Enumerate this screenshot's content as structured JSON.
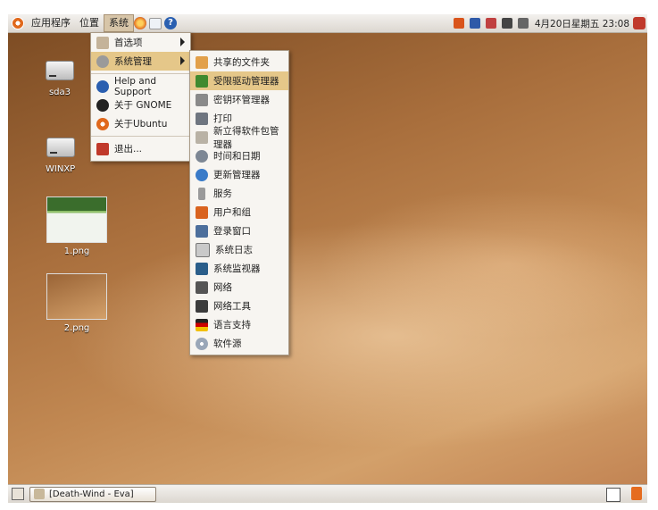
{
  "topbar": {
    "menus": [
      "应用程序",
      "位置",
      "系统"
    ],
    "clock": "4月20日星期五 23:08"
  },
  "desktop_icons": [
    {
      "label": "sda3"
    },
    {
      "label": "WINXP"
    },
    {
      "label": "1.png"
    },
    {
      "label": "2.png"
    }
  ],
  "system_menu": {
    "items": [
      {
        "label": "首选项",
        "icon": "preferences-icon"
      },
      {
        "label": "系统管理",
        "icon": "administration-icon"
      },
      {
        "label": "Help and Support",
        "icon": "help-icon"
      },
      {
        "label": "关于 GNOME",
        "icon": "gnome-foot-icon"
      },
      {
        "label": "关于Ubuntu",
        "icon": "ubuntu-icon"
      },
      {
        "label": "退出...",
        "icon": "quit-icon"
      }
    ]
  },
  "admin_menu": {
    "items": [
      {
        "label": "共享的文件夹"
      },
      {
        "label": "受限驱动管理器"
      },
      {
        "label": "密钥环管理器"
      },
      {
        "label": "打印"
      },
      {
        "label": "新立得软件包管理器"
      },
      {
        "label": "时间和日期"
      },
      {
        "label": "更新管理器"
      },
      {
        "label": "服务"
      },
      {
        "label": "用户和组"
      },
      {
        "label": "登录窗口"
      },
      {
        "label": "系统日志"
      },
      {
        "label": "系统监视器"
      },
      {
        "label": "网络"
      },
      {
        "label": "网络工具"
      },
      {
        "label": "语言支持"
      },
      {
        "label": "软件源"
      }
    ]
  },
  "taskbar": {
    "task_label": "[Death-Wind - Eva]"
  },
  "colors": {
    "highlight": "#e5c789",
    "accent": "#e0691d"
  }
}
